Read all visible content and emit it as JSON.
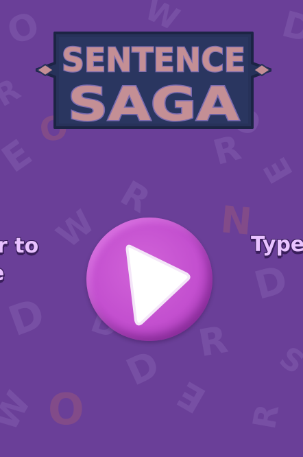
{
  "game": {
    "title_line1": "SENTENCE",
    "title_line2": "SAGA",
    "left_caption_line1": "r to",
    "left_caption_line2": "e",
    "right_caption": "Type",
    "play_icon": "play-icon"
  },
  "colors": {
    "background": "#6a3f98",
    "play_button": "#c34fcf",
    "caption_text": "#e9c2ff",
    "logo_fill": "#c48f95",
    "logo_outline": "#27325a"
  },
  "background_letters": [
    "O",
    "W",
    "E",
    "R",
    "R",
    "W",
    "D",
    "O",
    "E",
    "D",
    "R",
    "O",
    "D",
    "R",
    "E",
    "N",
    "O",
    "D",
    "W",
    "S",
    "R",
    "D"
  ]
}
